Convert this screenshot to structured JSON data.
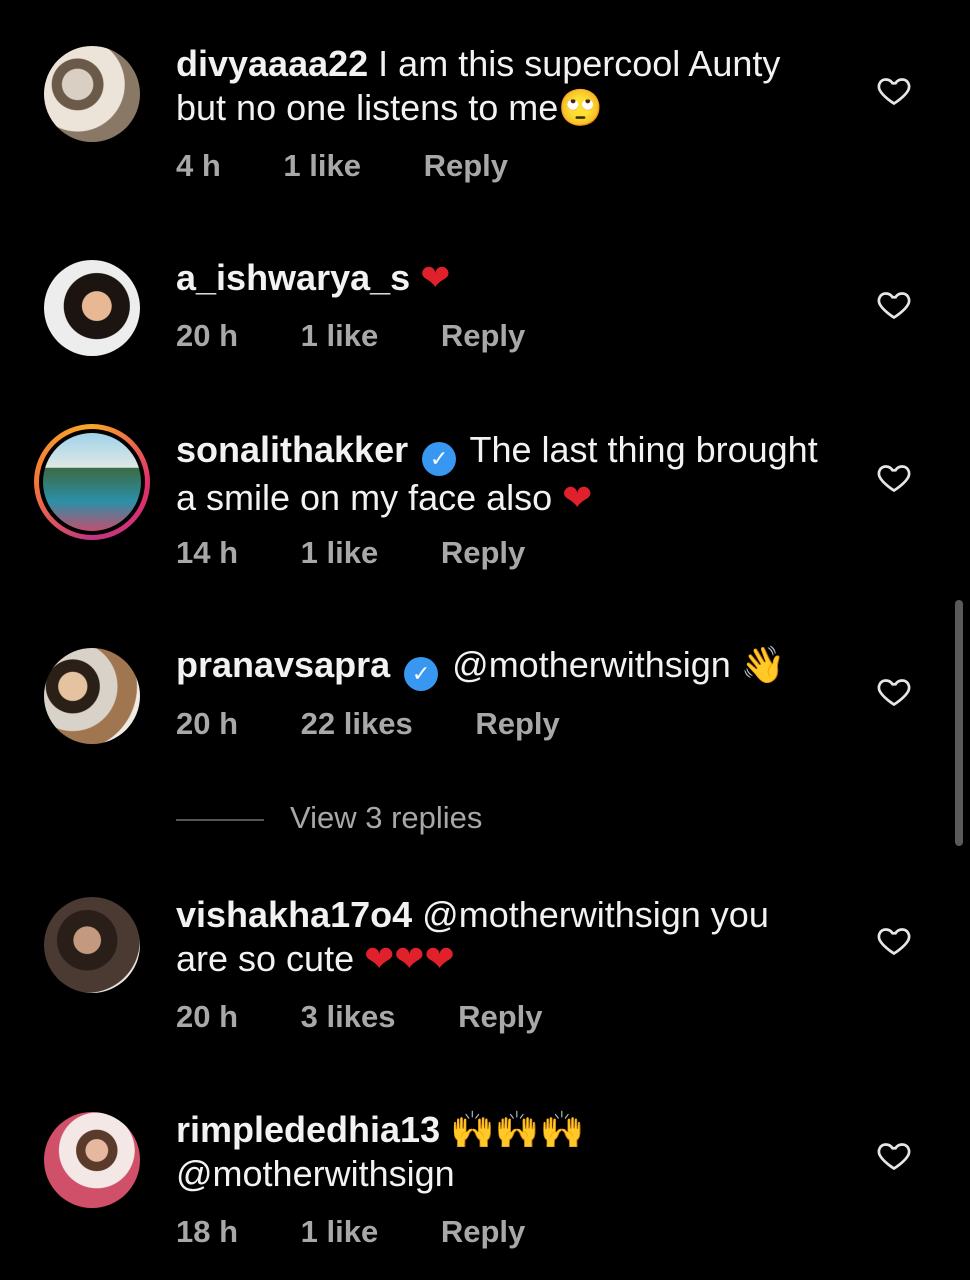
{
  "comments": [
    {
      "username": "divyaaaa22",
      "text_line1": " I am this supercool Aunty",
      "text_line2": "but no one listens to me",
      "emoji": "🙄",
      "time": "4 h",
      "likes": "1 like",
      "reply": "Reply"
    },
    {
      "username": "a_ishwarya_s",
      "emoji": "❤",
      "time": "20 h",
      "likes": "1 like",
      "reply": "Reply"
    },
    {
      "username": "sonalithakker",
      "text_line1": " The last thing brought",
      "text_line2": "a smile on my face also ",
      "emoji": "❤",
      "time": "14 h",
      "likes": "1 like",
      "reply": "Reply"
    },
    {
      "username": "pranavsapra",
      "text_line1": " @motherwithsign ",
      "emoji": "👋",
      "time": "20 h",
      "likes": "22 likes",
      "reply": "Reply"
    },
    {
      "username": "vishakha17o4",
      "text_line1": " @motherwithsign  you",
      "text_line2": "are so cute ",
      "emoji": "❤❤❤",
      "time": "20 h",
      "likes": "3 likes",
      "reply": "Reply"
    },
    {
      "username": "rimplededhia13",
      "emoji": "🙌🙌🙌",
      "text_line2": "@motherwithsign",
      "time": "18 h",
      "likes": "1 like",
      "reply": "Reply"
    }
  ],
  "view_replies": "View 3 replies",
  "icons": {
    "like": "heart-outline-icon",
    "verified": "verified-badge-icon"
  },
  "colors": {
    "background": "#000000",
    "secondary_text": "#a8a8a8",
    "verified": "#3897f0",
    "heart": "#e0202a"
  }
}
